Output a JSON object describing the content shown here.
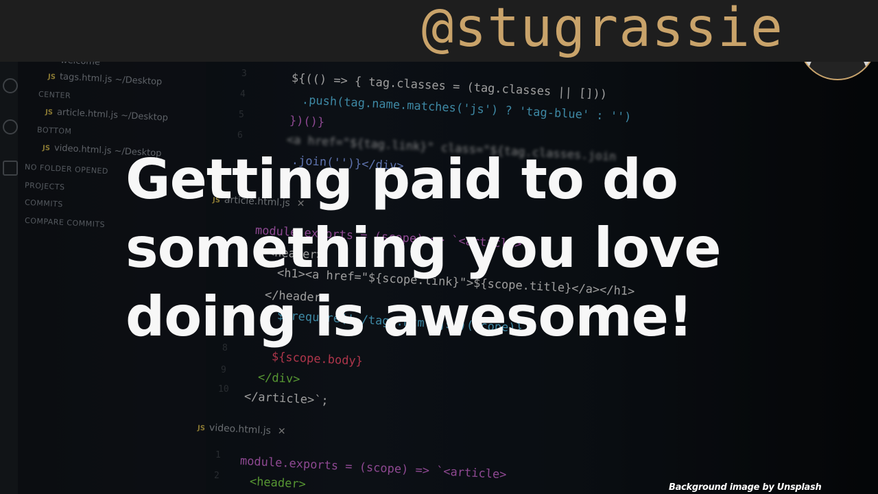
{
  "banner": {
    "handle": "@stugrassie"
  },
  "headline": {
    "lines": [
      "Getting paid to do",
      "something you love",
      "doing is awesome!"
    ]
  },
  "credit": "Background image by Unsplash",
  "background": {
    "sidebar": {
      "items": [
        {
          "kind": "file",
          "text": "welcome"
        },
        {
          "kind": "file",
          "text": "tags.html.js ~/Desktop"
        },
        {
          "kind": "label",
          "text": "CENTER"
        },
        {
          "kind": "file",
          "text": "article.html.js ~/Desktop"
        },
        {
          "kind": "label",
          "text": "BOTTOM"
        },
        {
          "kind": "file",
          "text": "video.html.js ~/Desktop"
        },
        {
          "kind": "section",
          "text": "NO FOLDER OPENED"
        },
        {
          "kind": "section",
          "text": "PROJECTS"
        },
        {
          "kind": "section",
          "text": "COMMITS"
        },
        {
          "kind": "section",
          "text": "COMPARE COMMITS"
        }
      ]
    },
    "tabs": [
      {
        "label": "article.html.js"
      },
      {
        "label": "video.html.js"
      }
    ],
    "line_numbers": [
      "3",
      "4",
      "5",
      "6",
      "8",
      "9",
      "10",
      "1",
      "2"
    ],
    "code_lines": [
      "${(() => { tag.classes = (tag.classes || []))",
      ".push(tag.name.matches('js') ? 'tag-blue' : '')",
      "})()}",
      "<a href=\"${tag.link}\" class=\"${tag.classes.join",
      ".join('')}</div>",
      "module.exports = (scope) => `<article>",
      "<header>",
      "<h1><a href=\"${scope.link}\">${scope.title}</a></h1>",
      "</header>",
      "${require('./tags.html.js')(scope)}",
      "${scope.body}",
      "</div>",
      "</article>`;",
      "module.exports = (scope) => `<article>",
      "<header>"
    ],
    "js_badge": "JS"
  }
}
